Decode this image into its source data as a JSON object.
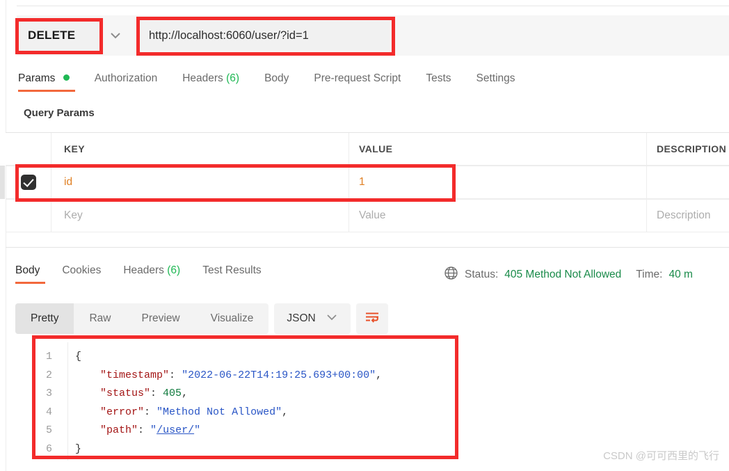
{
  "request": {
    "method": "DELETE",
    "url": "http://localhost:6060/user/?id=1",
    "caret_icon": "chevron-down-icon",
    "tabs": [
      {
        "label": "Params",
        "active": true,
        "dot": true
      },
      {
        "label": "Authorization",
        "active": false
      },
      {
        "label": "Headers",
        "count": "(6)",
        "active": false
      },
      {
        "label": "Body",
        "active": false
      },
      {
        "label": "Pre-request Script",
        "active": false
      },
      {
        "label": "Tests",
        "active": false
      },
      {
        "label": "Settings",
        "active": false
      }
    ],
    "section_title": "Query Params",
    "table": {
      "columns": [
        "KEY",
        "VALUE",
        "DESCRIPTION"
      ],
      "rows": [
        {
          "checked": true,
          "key": "id",
          "value": "1",
          "description": ""
        }
      ],
      "placeholder_row": {
        "key": "Key",
        "value": "Value",
        "description": "Description"
      }
    }
  },
  "response": {
    "tabs": [
      {
        "label": "Body",
        "active": true
      },
      {
        "label": "Cookies",
        "active": false
      },
      {
        "label": "Headers",
        "count": "(6)",
        "active": false
      },
      {
        "label": "Test Results",
        "active": false
      }
    ],
    "globe_icon": "globe-icon",
    "status_label": "Status:",
    "status_value": "405 Method Not Allowed",
    "time_label": "Time:",
    "time_value": "40 m",
    "viewer": {
      "modes": [
        {
          "label": "Pretty",
          "active": true
        },
        {
          "label": "Raw",
          "active": false
        },
        {
          "label": "Preview",
          "active": false
        },
        {
          "label": "Visualize",
          "active": false
        }
      ],
      "format": "JSON",
      "format_caret_icon": "chevron-down-icon",
      "wrap_icon": "word-wrap-icon"
    },
    "body_lines": [
      "1",
      "2",
      "3",
      "4",
      "5",
      "6"
    ],
    "body": {
      "line1": "{",
      "line2_key": "\"timestamp\"",
      "line2_sep": ": ",
      "line2_val": "\"2022-06-22T14:19:25.693+00:00\"",
      "line2_end": ",",
      "line3_key": "\"status\"",
      "line3_sep": ": ",
      "line3_val": "405",
      "line3_end": ",",
      "line4_key": "\"error\"",
      "line4_sep": ": ",
      "line4_val": "\"Method Not Allowed\"",
      "line4_end": ",",
      "line5_key": "\"path\"",
      "line5_sep": ": ",
      "line5_quote_open": "\"",
      "line5_link": "/user/",
      "line5_quote_close": "\"",
      "line6": "}"
    }
  },
  "watermark": "CSDN @可可西里的飞行",
  "colors": {
    "accent_orange": "#f2683c",
    "status_green": "#1a8b4a",
    "dot_green": "#1fb854",
    "annotation_red": "#f32b2b",
    "json_key": "#a31515",
    "json_string": "#2a56c6",
    "json_number": "#0f7a3d"
  }
}
